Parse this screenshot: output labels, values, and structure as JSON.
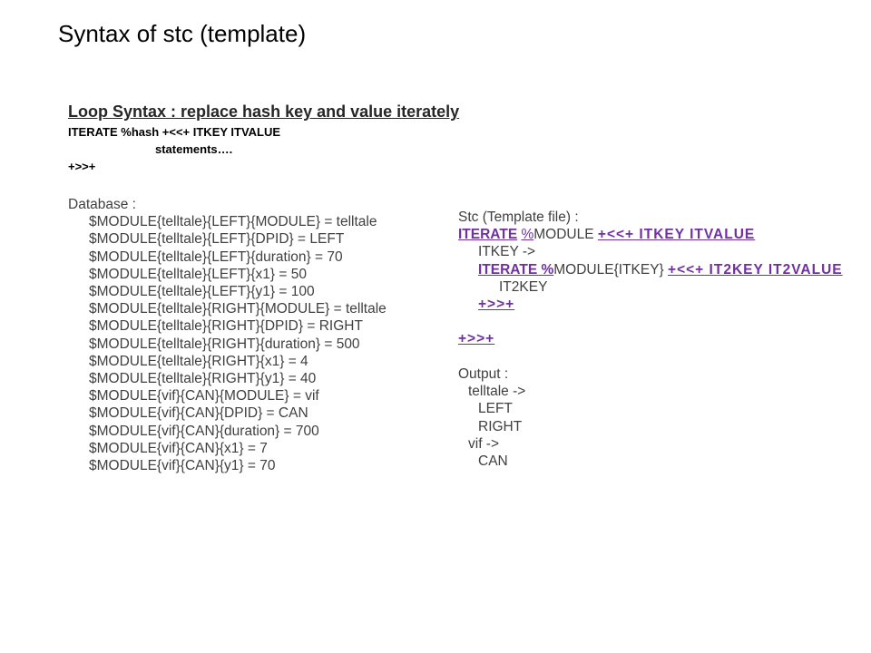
{
  "slide": {
    "title": "Syntax of stc (template)"
  },
  "loop_syntax": {
    "heading": "Loop Syntax : replace hash key and value iterately",
    "line1": "ITERATE %hash +<<+ ITKEY ITVALUE",
    "line2": "statements….",
    "line3": "+>>+"
  },
  "database": {
    "heading": "Database :",
    "lines": [
      "$MODULE{telltale}{LEFT}{MODULE} = telltale",
      "$MODULE{telltale}{LEFT}{DPID} = LEFT",
      "$MODULE{telltale}{LEFT}{duration} = 70",
      "$MODULE{telltale}{LEFT}{x1} = 50",
      "$MODULE{telltale}{LEFT}{y1} = 100",
      "$MODULE{telltale}{RIGHT}{MODULE} = telltale",
      "$MODULE{telltale}{RIGHT}{DPID} = RIGHT",
      "$MODULE{telltale}{RIGHT}{duration} = 500",
      "$MODULE{telltale}{RIGHT}{x1} = 4",
      "$MODULE{telltale}{RIGHT}{y1} = 40",
      "$MODULE{vif}{CAN}{MODULE} = vif",
      "$MODULE{vif}{CAN}{DPID} = CAN",
      "$MODULE{vif}{CAN}{duration} = 700",
      "$MODULE{vif}{CAN}{x1} = 7",
      "$MODULE{vif}{CAN}{y1} = 70"
    ]
  },
  "template": {
    "heading": "Stc (Template file) :",
    "iterate_kw": "ITERATE",
    "pct": "%",
    "module": "MODULE",
    "open_marker_1": "+<<+ ITKEY ITVALUE",
    "itkey_line": "ITKEY ->",
    "iterate2_kw": "ITERATE %",
    "module_itkey": "MODULE{ITKEY}",
    "open_marker_2": "+<<+ IT2KEY IT2VALUE",
    "it2key_line": "IT2KEY",
    "close_marker_inner": "+>>+",
    "close_marker_outer": "+>>+",
    "accent_color": "#7030a0"
  },
  "output": {
    "heading": "Output :",
    "lines": [
      {
        "text": "telltale ->",
        "level": 1
      },
      {
        "text": "LEFT",
        "level": 2
      },
      {
        "text": "RIGHT",
        "level": 2
      },
      {
        "text": "vif ->",
        "level": 1
      },
      {
        "text": "CAN",
        "level": 2
      }
    ]
  }
}
